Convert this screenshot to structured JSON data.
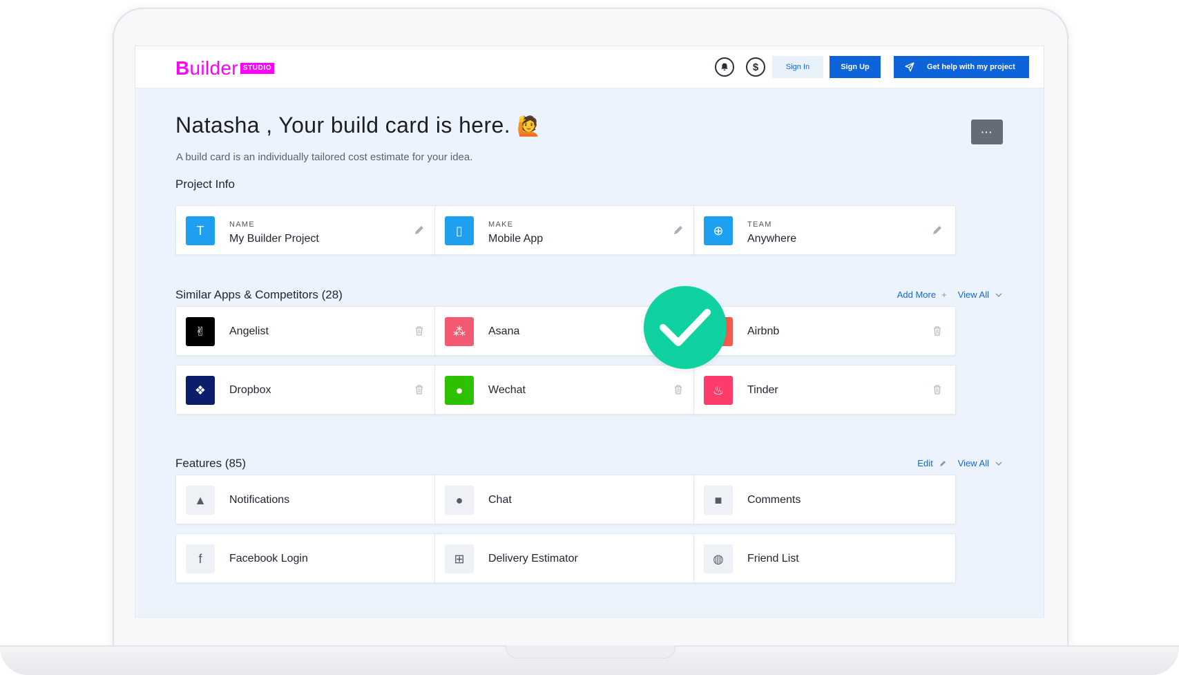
{
  "header": {
    "logo_word_first": "B",
    "logo_word_rest": "uilder",
    "logo_badge": "STUDIO",
    "bell_icon": "bell-icon",
    "dollar_symbol": "$",
    "sign_in_label": "Sign In",
    "sign_up_label": "Sign Up",
    "help_label": "Get help with my project"
  },
  "main": {
    "title": "Natasha , Your build card is here.",
    "title_emoji": "🙋",
    "subtitle": "A build card is an individually tailored cost estimate for your idea.",
    "more_label": "···"
  },
  "project_info": {
    "title": "Project Info",
    "cards": [
      {
        "label": "NAME",
        "value": "My Builder Project",
        "icon": "text-t-icon",
        "glyph": "T",
        "color": "#1f9ff0"
      },
      {
        "label": "MAKE",
        "value": "Mobile App",
        "icon": "mobile-phone-icon",
        "glyph": "▯",
        "color": "#1f9ff0"
      },
      {
        "label": "TEAM",
        "value": "Anywhere",
        "icon": "globe-icon",
        "glyph": "⊕",
        "color": "#1f9ff0"
      }
    ]
  },
  "similar_apps": {
    "title": "Similar Apps & Competitors (28)",
    "add_more": "Add More",
    "add_symbol": "+",
    "view_all": "View All",
    "apps": [
      {
        "name": "Angelist",
        "icon": "angelist-logo-icon",
        "color": "#000000",
        "glyph": "✌"
      },
      {
        "name": "Asana",
        "icon": "asana-logo-icon",
        "color": "#f25a72",
        "glyph": "⁂"
      },
      {
        "name": "Airbnb",
        "icon": "airbnb-logo-icon",
        "color": "#f55a4e",
        "glyph": "◬"
      },
      {
        "name": "Dropbox",
        "icon": "dropbox-logo-icon",
        "color": "#0c1d6b",
        "glyph": "❖"
      },
      {
        "name": "Wechat",
        "icon": "wechat-logo-icon",
        "color": "#2dc100",
        "glyph": "●"
      },
      {
        "name": "Tinder",
        "icon": "tinder-logo-icon",
        "color": "#fd3c6b",
        "glyph": "♨"
      }
    ]
  },
  "features": {
    "title": "Features (85)",
    "edit": "Edit",
    "view_all": "View All",
    "items": [
      {
        "name": "Notifications",
        "icon": "bell-icon",
        "glyph": "▲"
      },
      {
        "name": "Chat",
        "icon": "chat-bubble-icon",
        "glyph": "●"
      },
      {
        "name": "Comments",
        "icon": "comment-icon",
        "glyph": "■"
      },
      {
        "name": "Facebook Login",
        "icon": "facebook-icon",
        "glyph": "f"
      },
      {
        "name": "Delivery Estimator",
        "icon": "cart-icon",
        "glyph": "⊞"
      },
      {
        "name": "Friend List",
        "icon": "users-icon",
        "glyph": "◍"
      }
    ]
  },
  "overlay": {
    "check_icon": "checkmark-icon",
    "accent": "#0fd2a0"
  }
}
